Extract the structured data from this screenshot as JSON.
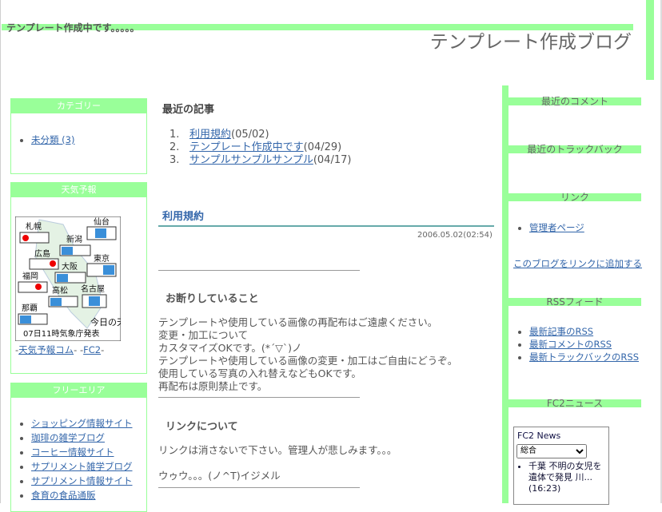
{
  "header": {
    "subtitle": "テンプレート作成中です。。。。。",
    "title": "テンプレート作成ブログ"
  },
  "left": {
    "category": {
      "heading": "カテゴリー",
      "items": [
        "未分類 (3)"
      ]
    },
    "weather": {
      "heading": "天気予報",
      "cities": [
        "札幌",
        "仙台",
        "新潟",
        "広島",
        "東京",
        "大阪",
        "福岡",
        "名古屋",
        "高松",
        "那覇"
      ],
      "caption1": "今日の天気",
      "caption2": "07日11時気象庁発表",
      "link1": "天気予報コム",
      "link2": "FC2"
    },
    "free": {
      "heading": "フリーエリア",
      "items": [
        "ショッピング情報サイト",
        "珈琲の雑学ブログ",
        "コーヒー情報サイト",
        "サプリメント雑学ブログ",
        "サプリメント情報サイト",
        "食育の食品通販"
      ]
    }
  },
  "main": {
    "recent_title": "最近の記事",
    "recent": [
      {
        "num": "1.",
        "title": "利用規約",
        "date": "(05/02)"
      },
      {
        "num": "2.",
        "title": "テンプレート作成中です",
        "date": "(04/29)"
      },
      {
        "num": "3.",
        "title": "サンプルサンプルサンプル",
        "date": "(04/17)"
      }
    ],
    "entry_title": "利用規約",
    "entry_date": "2006.05.02(02:54)",
    "section1_title": "お断りしていること",
    "section1_lines": [
      "テンプレートや使用している画像の再配布はご遠慮ください。",
      "変更・加工について",
      "カスタマイズOKです。(*´▽`)ノ",
      "テンプレートや使用している画像の変更・加工はご自由にどうぞ。",
      "使用している写真の入れ替えなどもOKです。",
      "再配布は原則禁止です。"
    ],
    "section2_title": "リンクについて",
    "section2_lines": [
      "リンクは消さないで下さい。管理人が悲しみます。。。",
      "ウゥウ。。。(ノ^T)イジメル"
    ]
  },
  "right": {
    "comments_heading": "最近のコメント",
    "trackback_heading": "最近のトラックバック",
    "link_heading": "リンク",
    "links": [
      "管理者ページ"
    ],
    "add_link": "このブログをリンクに追加する",
    "rss_heading": "RSSフィード",
    "rss": [
      "最新記事のRSS",
      "最新コメントのRSS",
      "最新トラックバックのRSS"
    ],
    "news_heading": "FC2ニュース",
    "news": {
      "title": "FC2 News",
      "select": "総合",
      "item": "千葉 不明の女児を遺体で発見 川...",
      "time": "(16:23)"
    }
  },
  "colors": {
    "accent": "#99ff99",
    "link": "#3366aa"
  }
}
